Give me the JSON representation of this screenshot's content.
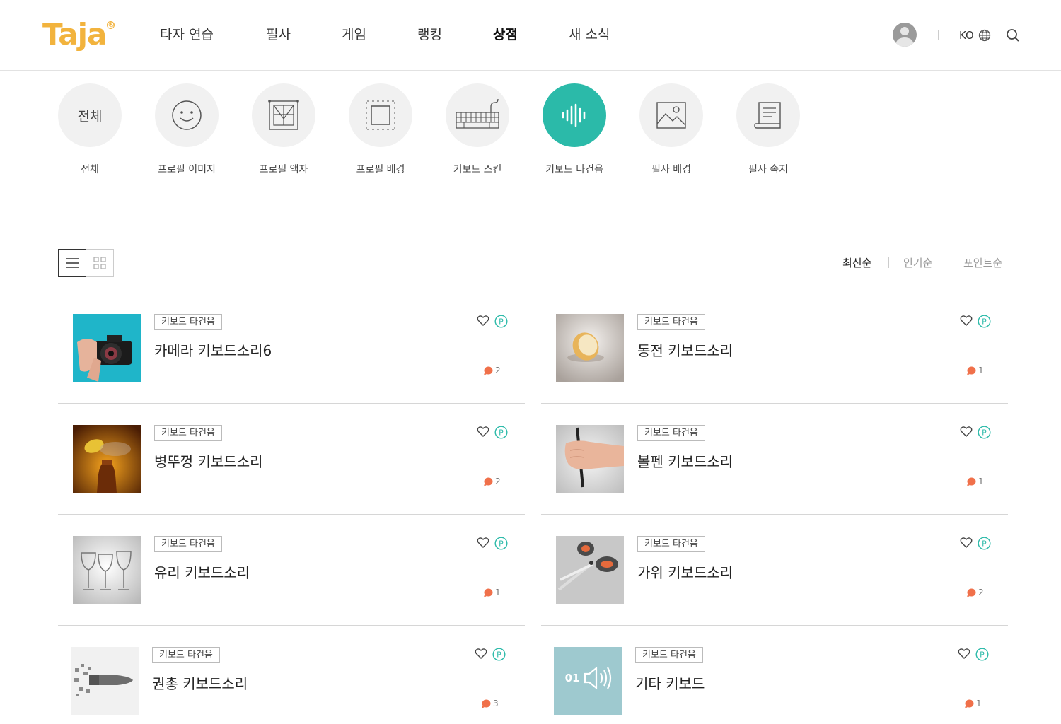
{
  "header": {
    "logo": "Taja",
    "logo_mark": "®",
    "nav": [
      {
        "label": "타자 연습"
      },
      {
        "label": "필사"
      },
      {
        "label": "게임"
      },
      {
        "label": "랭킹"
      },
      {
        "label": "상점",
        "active": true
      },
      {
        "label": "새 소식"
      }
    ],
    "lang": "KO"
  },
  "categories": [
    {
      "label": "전체",
      "circle_text": "전체",
      "icon": "all-text"
    },
    {
      "label": "프로필 이미지",
      "icon": "smiley-icon"
    },
    {
      "label": "프로필 액자",
      "icon": "frame-icon"
    },
    {
      "label": "프로필 배경",
      "icon": "background-icon"
    },
    {
      "label": "키보드 스킨",
      "icon": "keyboard-icon"
    },
    {
      "label": "키보드 타건음",
      "icon": "soundwave-icon",
      "active": true
    },
    {
      "label": "필사 배경",
      "icon": "image-icon"
    },
    {
      "label": "필사 속지",
      "icon": "paper-icon"
    }
  ],
  "sort": [
    {
      "label": "최신순",
      "active": true
    },
    {
      "label": "인기순"
    },
    {
      "label": "포인트순"
    }
  ],
  "colors": {
    "accent": "#2bbaa9",
    "logo": "#f2b33d",
    "comment": "#f0704a"
  },
  "items": [
    {
      "tag": "키보드 타건음",
      "title": "카메라 키보드소리6",
      "comments": "2",
      "thumb": "camera"
    },
    {
      "tag": "키보드 타건음",
      "title": "동전 키보드소리",
      "comments": "1",
      "thumb": "coin"
    },
    {
      "tag": "키보드 타건음",
      "title": "병뚜껑 키보드소리",
      "comments": "2",
      "thumb": "bottlecap"
    },
    {
      "tag": "키보드 타건음",
      "title": "볼펜 키보드소리",
      "comments": "1",
      "thumb": "pen"
    },
    {
      "tag": "키보드 타건음",
      "title": "유리 키보드소리",
      "comments": "1",
      "thumb": "glass"
    },
    {
      "tag": "키보드 타건음",
      "title": "가위 키보드소리",
      "comments": "2",
      "thumb": "scissors"
    },
    {
      "tag": "키보드 타건음",
      "title": "권총 키보드소리",
      "comments": "3",
      "thumb": "bullet"
    },
    {
      "tag": "키보드 타건음",
      "title": "기타 키보드",
      "comments": "1",
      "thumb": "speaker",
      "thumb_text": "01"
    }
  ]
}
